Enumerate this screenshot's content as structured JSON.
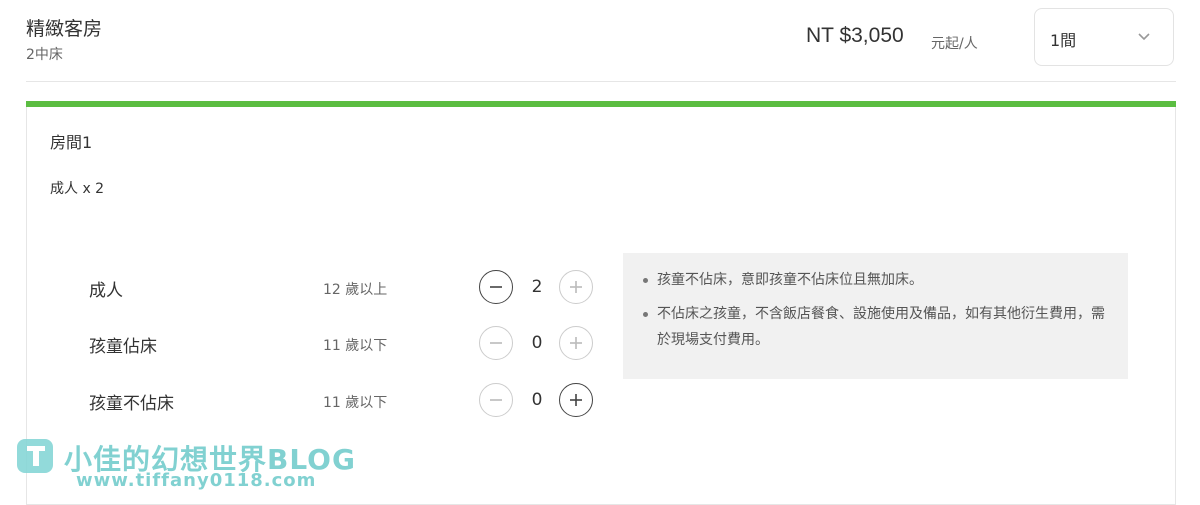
{
  "room": {
    "name": "精緻客房",
    "bed": "2中床",
    "price": "NT $3,050",
    "price_unit": "元起/人",
    "qty_value": "1間"
  },
  "panel": {
    "room_title": "房間1",
    "adults_summary": "成人 x 2",
    "rows": [
      {
        "label": "成人",
        "age": "12 歲以上",
        "count": "2"
      },
      {
        "label": "孩童佔床",
        "age": "11 歲以下",
        "count": "0"
      },
      {
        "label": "孩童不佔床",
        "age": "11 歲以下",
        "count": "0"
      }
    ],
    "notes": [
      "孩童不佔床，意即孩童不佔床位且無加床。",
      "不佔床之孩童，不含飯店餐食、設施使用及備品，如有其他衍生費用，需於現場支付費用。"
    ]
  },
  "watermark": {
    "title": "小佳的幻想世界BLOG",
    "url": "www.tiffany0118.com"
  },
  "colors": {
    "accent": "#5bbd41",
    "watermark": "#6cc9c9"
  }
}
